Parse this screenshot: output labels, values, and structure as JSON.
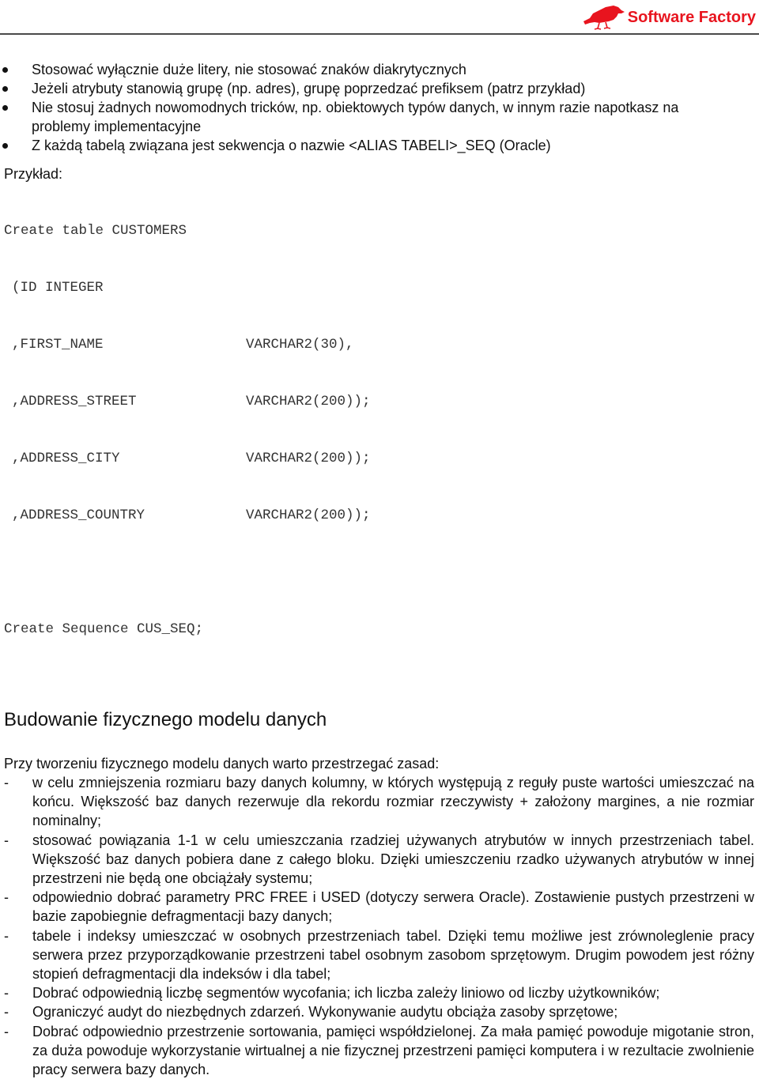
{
  "header": {
    "brand": "Software Factory",
    "logo_icon": "red-bird-logo-icon",
    "brand_color": "#e8141e"
  },
  "bullets": [
    "Stosować wyłącznie duże litery, nie stosować znaków diakrytycznych",
    "Jeżeli atrybuty stanowią grupę (np. adres), grupę poprzedzać prefiksem (patrz przykład)",
    "Nie stosuj żadnych nowomodnych tricków, np. obiektowych typów danych, w innym razie napotkasz na problemy implementacyjne",
    "Z każdą tabelą związana jest sekwencja o nazwie <ALIAS TABELI>_SEQ (Oracle)"
  ],
  "example": {
    "label": "Przykład:",
    "create_table": "Create table CUSTOMERS",
    "columns": [
      {
        "name": "(ID INTEGER",
        "type": ""
      },
      {
        "name": ",FIRST_NAME",
        "type": "VARCHAR2(30),"
      },
      {
        "name": ",ADDRESS_STREET",
        "type": "VARCHAR2(200));"
      },
      {
        "name": ",ADDRESS_CITY",
        "type": "VARCHAR2(200));"
      },
      {
        "name": ",ADDRESS_COUNTRY",
        "type": "VARCHAR2(200));"
      }
    ],
    "create_sequence": "Create Sequence CUS_SEQ;"
  },
  "section": {
    "title": "Budowanie fizycznego modelu danych",
    "intro": "Przy tworzeniu fizycznego modelu danych warto przestrzegać zasad:",
    "rules": [
      "w celu zmniejszenia rozmiaru bazy danych kolumny, w których występują z reguły puste wartości umieszczać na końcu. Większość baz danych rezerwuje dla rekordu rozmiar rzeczywisty + założony margines, a nie rozmiar nominalny;",
      "stosować powiązania 1-1 w celu umieszczania rzadziej używanych atrybutów w innych przestrzeniach tabel. Większość baz danych pobiera dane z całego bloku. Dzięki umieszczeniu rzadko używanych atrybutów w innej przestrzeni nie będą one obciążały systemu;",
      "odpowiednio dobrać parametry PRC FREE i USED (dotyczy serwera Oracle). Zostawienie pustych przestrzeni w bazie zapobiegnie defragmentacji bazy danych;",
      "tabele i indeksy umieszczać w osobnych przestrzeniach tabel. Dzięki temu możliwe jest zrównoleglenie pracy serwera przez przyporządkowanie przestrzeni tabel osobnym zasobom sprzętowym. Drugim powodem jest różny stopień defragmentacji dla indeksów i dla tabel;",
      "Dobrać odpowiednią liczbę segmentów wycofania;  ich liczba zależy liniowo od liczby użytkowników;",
      "Ograniczyć audyt do niezbędnych zdarzeń. Wykonywanie audytu obciąża zasoby sprzętowe;",
      "Dobrać odpowiednio przestrzenie sortowania, pamięci współdzielonej. Za mała pamięć powoduje migotanie stron, za duża powoduje wykorzystanie wirtualnej a nie fizycznej przestrzeni pamięci komputera i w rezultacie zwolnienie pracy serwera bazy danych."
    ],
    "dash": "-"
  }
}
